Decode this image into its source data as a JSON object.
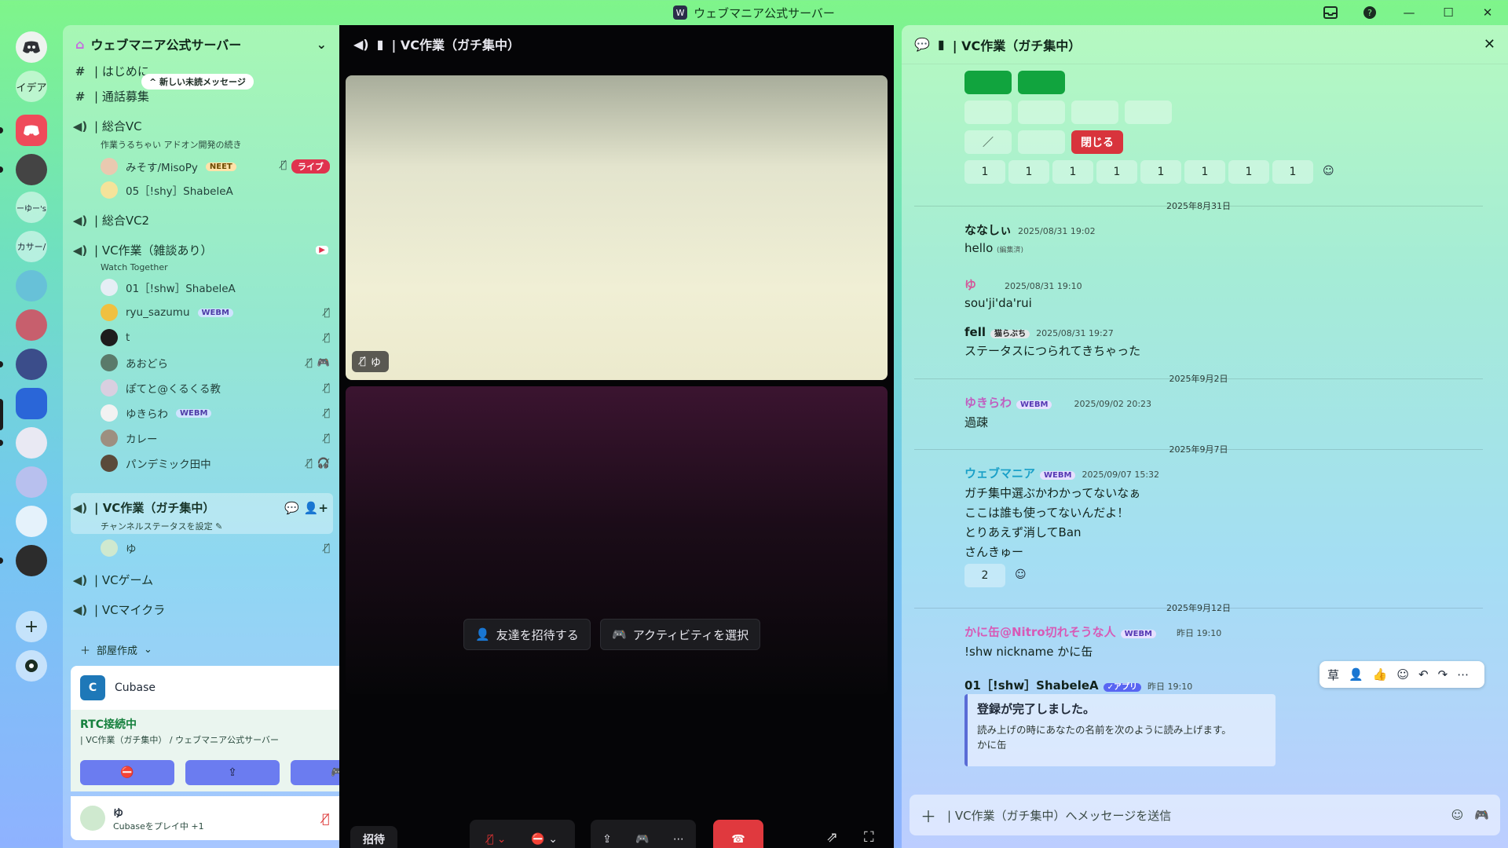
{
  "window": {
    "title": "ウェブマニア公式サーバー"
  },
  "rail": {
    "items": [
      "イデア",
      "ーゆー's",
      "カサー/"
    ]
  },
  "server": {
    "name": "ウェブマニア公式サーバー",
    "new_unread": "新しい未読メッセージ"
  },
  "channels": {
    "c1": "| はじめに",
    "c2": "| 通話募集",
    "c3": "| 総合VC",
    "c3_sub": "作業うるちゃい アドオン開発の続き",
    "c3_u1": "みそす/MisoPy",
    "c3_u1_tag": "NEET",
    "live": "ライブ",
    "c3_u2": "05［!shy］ShabeleA",
    "c4": "| 総合VC2",
    "c5": "| VC作業（雑談あり）",
    "c5_sub": "Watch Together",
    "c5_users": [
      "01［!shw］ShabeleA",
      "ryu_sazumu",
      "t",
      "あおどら",
      "ぽてと@くるくる教",
      "ゆきらわ",
      "カレー",
      "パンデミック田中"
    ],
    "c5_tag": "WEBM",
    "c6": "| VC作業（ガチ集中）",
    "c6_sub": "チャンネルステータスを設定",
    "c6_u1": "ゆ",
    "c7": "| VCゲーム",
    "c8": "| VCマイクラ",
    "create": "部屋作成"
  },
  "activity": {
    "app": "Cubase"
  },
  "rtc": {
    "status": "RTC接続中",
    "detail": "| VC作業（ガチ集中） / ウェブマニア公式サーバー"
  },
  "me": {
    "name": "ゆ",
    "status": "Cubaseをプレイ中 +1"
  },
  "stage": {
    "title": "| VC作業（ガチ集中）",
    "tile_name": "ゆ",
    "invite_friends": "友達を招待する",
    "choose_activity": "アクティビティを選択",
    "invite": "招待"
  },
  "chat": {
    "title": "| VC作業（ガチ集中）",
    "close_btn": "閉じる",
    "slash": "／",
    "counts": [
      "1",
      "1",
      "1",
      "1",
      "1",
      "1",
      "1",
      "1"
    ],
    "dates": [
      "2025年8月31日",
      "2025年9月2日",
      "2025年9月7日",
      "2025年9月12日"
    ],
    "m1_name": "ななしぃ",
    "m1_ts": "2025/08/31 19:02",
    "m1_text": "hello",
    "m1_edited": "(編集済)",
    "m2_name": "ゆ",
    "m2_ts": "2025/08/31 19:10",
    "m2_text": "sou'ji'da'rui",
    "m3_name": "fell",
    "m3_tag": "猫らぶち",
    "m3_ts": "2025/08/31 19:27",
    "m3_text": "ステータスにつられてきちゃった",
    "m4_name": "ゆきらわ",
    "m4_tag": "WEBM",
    "m4_ts": "2025/09/02 20:23",
    "m4_text": "過疎",
    "m5_name": "ウェブマニア",
    "m5_tag": "WEBM",
    "m5_ts": "2025/09/07 15:32",
    "m5_lines": [
      "ガチ集中選ぶかわかってないなぁ",
      "ここは誰も使ってないんだよ！",
      "とりあえず消してBan",
      "さんきゅー"
    ],
    "m5_react": "2",
    "m6_name": "かに缶@Nitro切れそうな人",
    "m6_tag": "WEBM",
    "m6_ts": "昨日 19:10",
    "m6_text": "!shw nickname かに缶",
    "m7_name": "01［!shw］ShabeleA",
    "m7_tag": "✓アプリ",
    "m7_ts": "昨日 19:10",
    "embed_title": "登録が完了しました。",
    "embed_body": "読み上げの時にあなたの名前を次のように読み上げます。",
    "embed_name": "かに缶",
    "input_placeholder": "| VC作業（ガチ集中）へメッセージを送信"
  }
}
